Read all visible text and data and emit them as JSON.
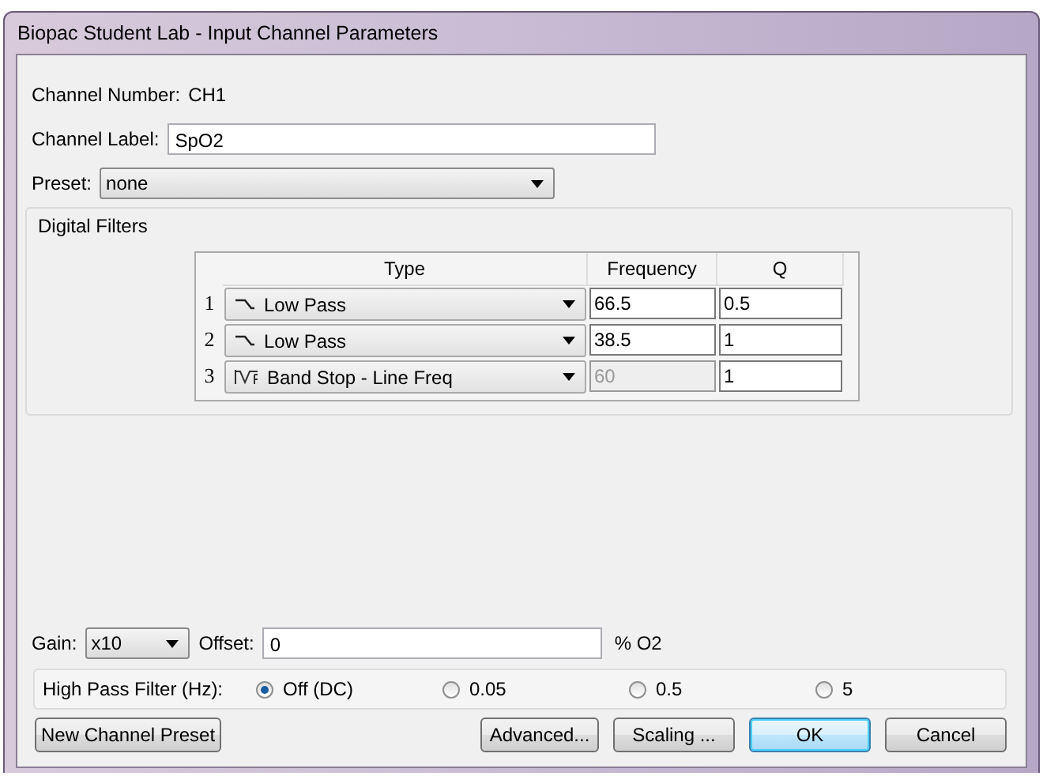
{
  "window": {
    "title": "Biopac Student Lab - Input Channel Parameters"
  },
  "channel_number": {
    "label": "Channel Number:",
    "value": "CH1"
  },
  "channel_label": {
    "label": "Channel Label:",
    "value": "SpO2"
  },
  "preset": {
    "label": "Preset:",
    "value": "none"
  },
  "digital_filters": {
    "title": "Digital Filters",
    "columns": [
      "Type",
      "Frequency",
      "Q"
    ],
    "rows": [
      {
        "number": "1",
        "kind": "low_pass",
        "type": "Low Pass",
        "frequency": "66.5",
        "frequency_disabled": false,
        "q": "0.5"
      },
      {
        "number": "2",
        "kind": "low_pass",
        "type": "Low Pass",
        "frequency": "38.5",
        "frequency_disabled": false,
        "q": "1"
      },
      {
        "number": "3",
        "kind": "band_stop",
        "type": "Band Stop - Line Freq",
        "frequency": "60",
        "frequency_disabled": true,
        "q": "1"
      }
    ]
  },
  "gain": {
    "label": "Gain:",
    "value": "x10"
  },
  "offset": {
    "label": "Offset:",
    "value": "0",
    "unit": "% O2"
  },
  "high_pass_filter": {
    "label": "High Pass Filter (Hz):",
    "options": [
      {
        "label": "Off (DC)",
        "selected": true
      },
      {
        "label": "0.05",
        "selected": false
      },
      {
        "label": "0.5",
        "selected": false
      },
      {
        "label": "5",
        "selected": false
      }
    ]
  },
  "buttons": [
    {
      "label": "New Channel Preset",
      "default": false
    },
    {
      "label": "Advanced...",
      "default": false
    },
    {
      "label": "Scaling ...",
      "default": false
    },
    {
      "label": "OK",
      "default": true
    },
    {
      "label": "Cancel",
      "default": false
    }
  ]
}
